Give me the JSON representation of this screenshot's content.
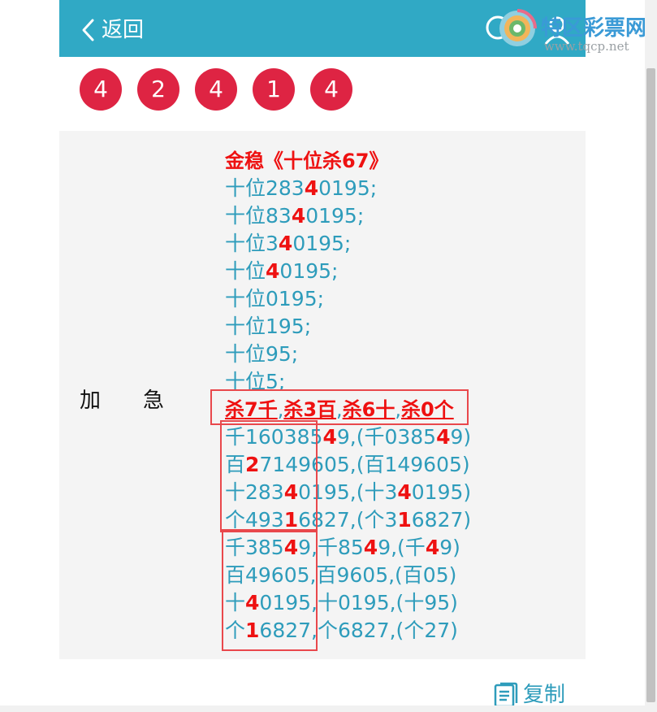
{
  "header": {
    "back_label": "返回"
  },
  "watermark": {
    "title": "特区彩票网",
    "url": "www.tqcp.net"
  },
  "draw_numbers": [
    "4",
    "2",
    "4",
    "1",
    "4"
  ],
  "category": {
    "char1": "加",
    "char2": "急"
  },
  "colors": {
    "header_bg": "#30a9c5",
    "ball_bg": "#de2443",
    "text_blue": "#2e9cbb",
    "highlight_red": "#ee1111",
    "box_red": "#e9484c"
  },
  "lines": [
    [
      {
        "t": "金稳《十位杀67》",
        "r": true
      }
    ],
    [
      {
        "t": "十位283"
      },
      {
        "t": "4",
        "r": true
      },
      {
        "t": "0195;"
      }
    ],
    [
      {
        "t": "十位83"
      },
      {
        "t": "4",
        "r": true
      },
      {
        "t": "0195;"
      }
    ],
    [
      {
        "t": "十位3"
      },
      {
        "t": "4",
        "r": true
      },
      {
        "t": "0195;"
      }
    ],
    [
      {
        "t": "十位"
      },
      {
        "t": "4",
        "r": true
      },
      {
        "t": "0195;"
      }
    ],
    [
      {
        "t": "十位0195;"
      }
    ],
    [
      {
        "t": "十位195;"
      }
    ],
    [
      {
        "t": "十位95;"
      }
    ],
    [
      {
        "t": "十位5;"
      }
    ],
    [
      {
        "t": "杀7千",
        "r": true
      },
      {
        "t": ","
      },
      {
        "t": "杀3百",
        "r": true
      },
      {
        "t": ","
      },
      {
        "t": "杀6十",
        "r": true
      },
      {
        "t": ","
      },
      {
        "t": "杀0个",
        "r": true
      }
    ],
    [
      {
        "t": "千160385"
      },
      {
        "t": "4",
        "r": true
      },
      {
        "t": "9,(千0385"
      },
      {
        "t": "4",
        "r": true
      },
      {
        "t": "9)"
      }
    ],
    [
      {
        "t": "百"
      },
      {
        "t": "2",
        "r": true
      },
      {
        "t": "7149605,(百149605)"
      }
    ],
    [
      {
        "t": "十283"
      },
      {
        "t": "4",
        "r": true
      },
      {
        "t": "0195,(十3"
      },
      {
        "t": "4",
        "r": true
      },
      {
        "t": "0195)"
      }
    ],
    [
      {
        "t": "个493"
      },
      {
        "t": "1",
        "r": true
      },
      {
        "t": "6827,(个3"
      },
      {
        "t": "1",
        "r": true
      },
      {
        "t": "6827)"
      }
    ],
    [
      {
        "t": "千385"
      },
      {
        "t": "4",
        "r": true
      },
      {
        "t": "9,千85"
      },
      {
        "t": "4",
        "r": true
      },
      {
        "t": "9,(千"
      },
      {
        "t": "4",
        "r": true
      },
      {
        "t": "9)"
      }
    ],
    [
      {
        "t": "百49605,百9605,(百05)"
      }
    ],
    [
      {
        "t": "十"
      },
      {
        "t": "4",
        "r": true
      },
      {
        "t": "0195,十0195,(十95)"
      }
    ],
    [
      {
        "t": "个"
      },
      {
        "t": "1",
        "r": true
      },
      {
        "t": "6827,个6827,(个27)"
      }
    ]
  ],
  "copy": {
    "label": "复制"
  }
}
